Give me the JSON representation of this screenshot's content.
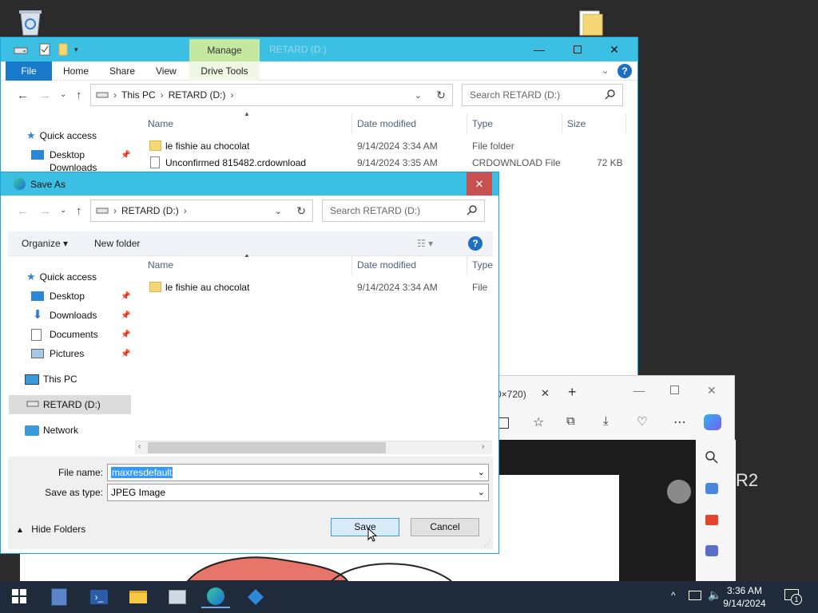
{
  "explorer": {
    "title_faded": "RETARD (D:)",
    "ribbon": {
      "file": "File",
      "home": "Home",
      "share": "Share",
      "view": "View",
      "manage": "Manage",
      "drive_tools": "Drive Tools"
    },
    "address": [
      "This PC",
      "RETARD (D:)"
    ],
    "search_placeholder": "Search RETARD (D:)",
    "columns": [
      "Name",
      "Date modified",
      "Type",
      "Size"
    ],
    "nav": [
      "Quick access",
      "Desktop",
      "Downloads"
    ],
    "rows": [
      {
        "name": "le fishie au chocolat",
        "date": "9/14/2024 3:34 AM",
        "type": "File folder",
        "size": ""
      },
      {
        "name": "Unconfirmed 815482.crdownload",
        "date": "9/14/2024 3:35 AM",
        "type": "CRDOWNLOAD File",
        "size": "72 KB"
      }
    ]
  },
  "edge": {
    "tab_fragment": "0×720)",
    "overflow_text": "R2"
  },
  "saveas": {
    "title": "Save As",
    "address": [
      "RETARD (D:)"
    ],
    "search_placeholder": "Search RETARD (D:)",
    "organize": "Organize ▾",
    "new_folder": "New folder",
    "columns": [
      "Name",
      "Date modified",
      "Type"
    ],
    "nav": {
      "quick_access": "Quick access",
      "desktop": "Desktop",
      "downloads": "Downloads",
      "documents": "Documents",
      "pictures": "Pictures",
      "this_pc": "This PC",
      "retard": "RETARD (D:)",
      "network": "Network"
    },
    "rows": [
      {
        "name": "le fishie au chocolat",
        "date": "9/14/2024 3:34 AM",
        "type": "File fo"
      }
    ],
    "file_name_label": "File name:",
    "file_name_value": "maxresdefault",
    "save_type_label": "Save as type:",
    "save_type_value": "JPEG Image",
    "hide_folders": "Hide Folders",
    "save_btn": "Save",
    "cancel_btn": "Cancel"
  },
  "taskbar": {
    "time": "3:36 AM",
    "date": "9/14/2024",
    "notifications": "1"
  },
  "colors": {
    "titlebar": "#3bbfe3",
    "accent_border": "#1ba1e2",
    "close_red": "#c75050",
    "selection": "#3399ff",
    "taskbar": "#1f2b3a"
  }
}
